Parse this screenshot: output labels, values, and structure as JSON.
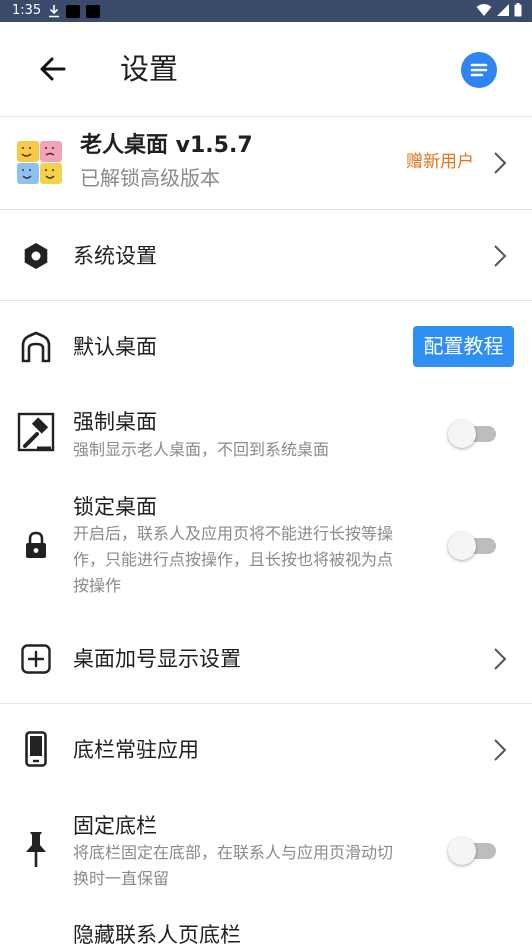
{
  "status_bar": {
    "time": "1:35"
  },
  "app_bar": {
    "title": "设置"
  },
  "profile": {
    "app_name": "老人桌面 v1.5.7",
    "subtitle": "已解锁高级版本",
    "action": "赠新用户"
  },
  "items": {
    "system_settings": {
      "label": "系统设置"
    },
    "default_desktop": {
      "label": "默认桌面",
      "button": "配置教程"
    },
    "force_desktop": {
      "label": "强制桌面",
      "desc": "强制显示老人桌面，不回到系统桌面",
      "enabled": false
    },
    "lock_desktop": {
      "label": "锁定桌面",
      "desc_lines": [
        "开启后，联系人及应用页将不能进行长按等操",
        "作，只能进行点按操作，且长按也将被视为点",
        "按操作"
      ],
      "enabled": false
    },
    "plus_settings": {
      "label": "桌面加号显示设置"
    },
    "dock_apps": {
      "label": "底栏常驻应用"
    },
    "fixed_dock": {
      "label": "固定底栏",
      "desc_lines": [
        "将底栏固定在底部，在联系人与应用页滑动切",
        "换时一直保留"
      ],
      "enabled": false
    },
    "hide_contacts_dock": {
      "label": "隐藏联系人页底栏"
    }
  },
  "colors": {
    "accent": "#2f8ff3",
    "promo": "#e8711a",
    "status_bar": "#3a4a6b"
  }
}
